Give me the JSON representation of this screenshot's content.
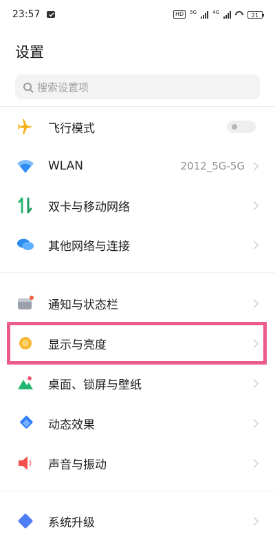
{
  "status_bar": {
    "time": "23:57",
    "hd_badge": "HD",
    "net1": "5G",
    "net2": "4G",
    "battery": "21"
  },
  "header": {
    "title": "设置"
  },
  "search": {
    "placeholder": "搜索设置项"
  },
  "settings": [
    {
      "label": "飞行模式",
      "icon": "airplane-icon",
      "control": "toggle",
      "toggle_on": false
    },
    {
      "label": "WLAN",
      "icon": "wifi-icon",
      "value": "2012_5G-5G"
    },
    {
      "label": "双卡与移动网络",
      "icon": "dual-sim-icon"
    },
    {
      "label": "其他网络与连接",
      "icon": "connection-icon"
    },
    {
      "label": "通知与状态栏",
      "icon": "notification-icon"
    },
    {
      "label": "显示与亮度",
      "icon": "brightness-icon",
      "highlighted": true
    },
    {
      "label": "桌面、锁屏与壁纸",
      "icon": "wallpaper-icon"
    },
    {
      "label": "动态效果",
      "icon": "animation-icon"
    },
    {
      "label": "声音与振动",
      "icon": "sound-icon"
    },
    {
      "label": "系统升级",
      "icon": "system-update-icon"
    }
  ],
  "colors": {
    "highlight_border": "#ec5b8e",
    "airplane": "#f5b21b",
    "wifi": "#2f8cf5",
    "dual_sim": "#2bb673",
    "connection": "#2d8cf0",
    "brightness": "#f7b731",
    "wallpaper": "#22b573",
    "animation": "#2f7cf6",
    "sound": "#f0504f"
  }
}
